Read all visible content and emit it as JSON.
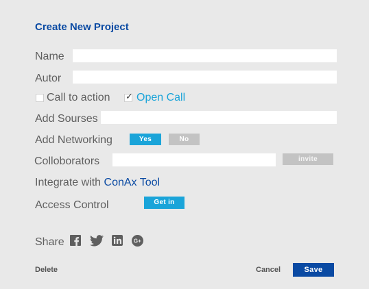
{
  "form": {
    "title": "Create New Project",
    "name_label": "Name",
    "autor_label": "Autor",
    "call_to_action_label": "Call to action",
    "open_call_label": "Open Call",
    "add_sourses_label": "Add Sourses",
    "add_networking_label": "Add Networking",
    "yes_label": "Yes",
    "no_label": "No",
    "collaborators_label": "Colloborators",
    "invite_label": "invite",
    "integrate_label": "Integrate with",
    "conax_label": "ConAx Tool",
    "access_control_label": "Access Control",
    "get_in_label": "Get in",
    "share_label": "Share",
    "delete_label": "Delete",
    "cancel_label": "Cancel",
    "save_label": "Save"
  },
  "state": {
    "call_to_action_checked": false,
    "open_call_checked": true,
    "networking_selected": "Yes"
  },
  "icons": {
    "share": [
      "facebook-icon",
      "twitter-icon",
      "linkedin-icon",
      "google-plus-icon"
    ]
  },
  "colors": {
    "title": "#0a4aa3",
    "accent_teal": "#1aa4d9",
    "primary_blue": "#0a4aa3",
    "muted_gray": "#c3c3c3",
    "background": "#e9e9e9"
  }
}
